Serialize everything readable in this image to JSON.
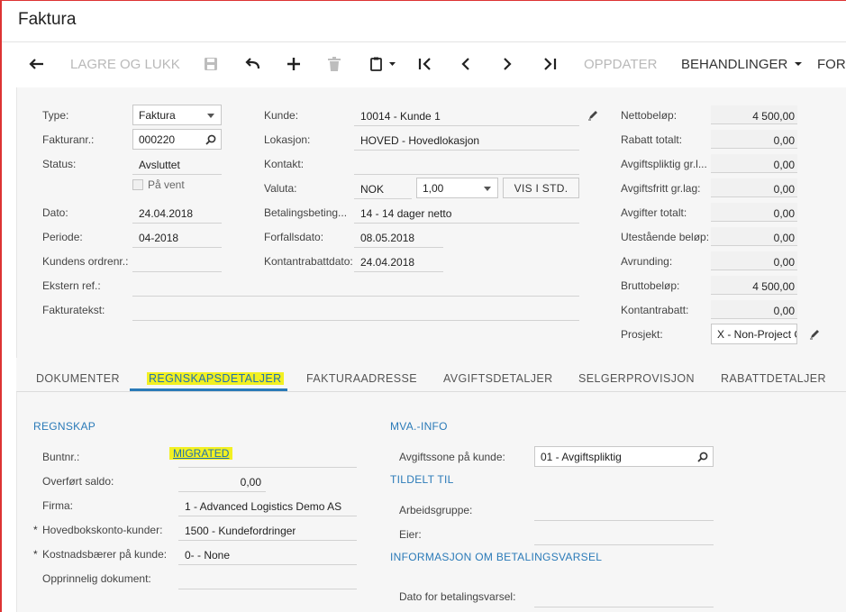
{
  "header": {
    "title": "Faktura"
  },
  "toolbar": {
    "save_close": "LAGRE OG LUKK",
    "update": "OPPDATER",
    "actions": "BEHANDLINGER",
    "more": "FOR"
  },
  "form": {
    "type_label": "Type:",
    "type_value": "Faktura",
    "invoice_label": "Fakturanr.:",
    "invoice_value": "000220",
    "status_label": "Status:",
    "status_value": "Avsluttet",
    "hold_label": "På vent",
    "date_label": "Dato:",
    "date_value": "24.04.2018",
    "period_label": "Periode:",
    "period_value": "04-2018",
    "order_label": "Kundens ordrenr.:",
    "extref_label": "Ekstern ref.:",
    "text_label": "Fakturatekst:",
    "customer_label": "Kunde:",
    "customer_value": "10014 - Kunde 1",
    "location_label": "Lokasjon:",
    "location_value": "HOVED - Hovedlokasjon",
    "contact_label": "Kontakt:",
    "currency_label": "Valuta:",
    "currency_value": "NOK",
    "rate_value": "1,00",
    "view_base": "VIS I STD.",
    "terms_label": "Betalingsbeting...",
    "terms_value": "14 - 14 dager netto",
    "due_label": "Forfallsdato:",
    "due_value": "08.05.2018",
    "cashdisc_label": "Kontantrabattdato:",
    "cashdisc_value": "24.04.2018"
  },
  "totals": [
    {
      "label": "Nettobeløp:",
      "value": "4 500,00"
    },
    {
      "label": "Rabatt totalt:",
      "value": "0,00"
    },
    {
      "label": "Avgiftspliktig gr.l...",
      "value": "0,00"
    },
    {
      "label": "Avgiftsfritt gr.lag:",
      "value": "0,00"
    },
    {
      "label": "Avgifter totalt:",
      "value": "0,00"
    },
    {
      "label": "Utestående beløp:",
      "value": "0,00"
    },
    {
      "label": "Avrunding:",
      "value": "0,00"
    },
    {
      "label": "Bruttobeløp:",
      "value": "4 500,00"
    },
    {
      "label": "Kontantrabatt:",
      "value": "0,00"
    }
  ],
  "project": {
    "label": "Prosjekt:",
    "value": "X - Non-Project C"
  },
  "tabs": [
    "DOKUMENTER",
    "REGNSKAPSDETALJER",
    "FAKTURAADRESSE",
    "AVGIFTSDETALJER",
    "SELGERPROVISJON",
    "RABATTDETALJER"
  ],
  "accounting": {
    "title": "REGNSKAP",
    "batch_label": "Buntnr.:",
    "batch_value": "MIGRATED",
    "balance_label": "Overført saldo:",
    "balance_value": "0,00",
    "company_label": "Firma:",
    "company_value": "1 - Advanced Logistics Demo AS",
    "ar_label": "Hovedbokskonto-kunder:",
    "ar_value": "1500 - Kundefordringer",
    "cost_label": "Kostnadsbærer på kunde:",
    "cost_value": "0- - None",
    "orig_label": "Opprinnelig dokument:"
  },
  "vat": {
    "title": "MVA.-INFO",
    "zone_label": "Avgiftssone på kunde:",
    "zone_value": "01 - Avgiftspliktig"
  },
  "assigned": {
    "title": "TILDELT TIL",
    "group_label": "Arbeidsgruppe:",
    "owner_label": "Eier:"
  },
  "dunning": {
    "title": "INFORMASJON OM BETALINGSVARSEL",
    "date_label": "Dato for betalingsvarsel:"
  },
  "colors": {
    "accent": "#2a7ab8",
    "highlight": "#f2f022",
    "frame": "#dd3333"
  }
}
